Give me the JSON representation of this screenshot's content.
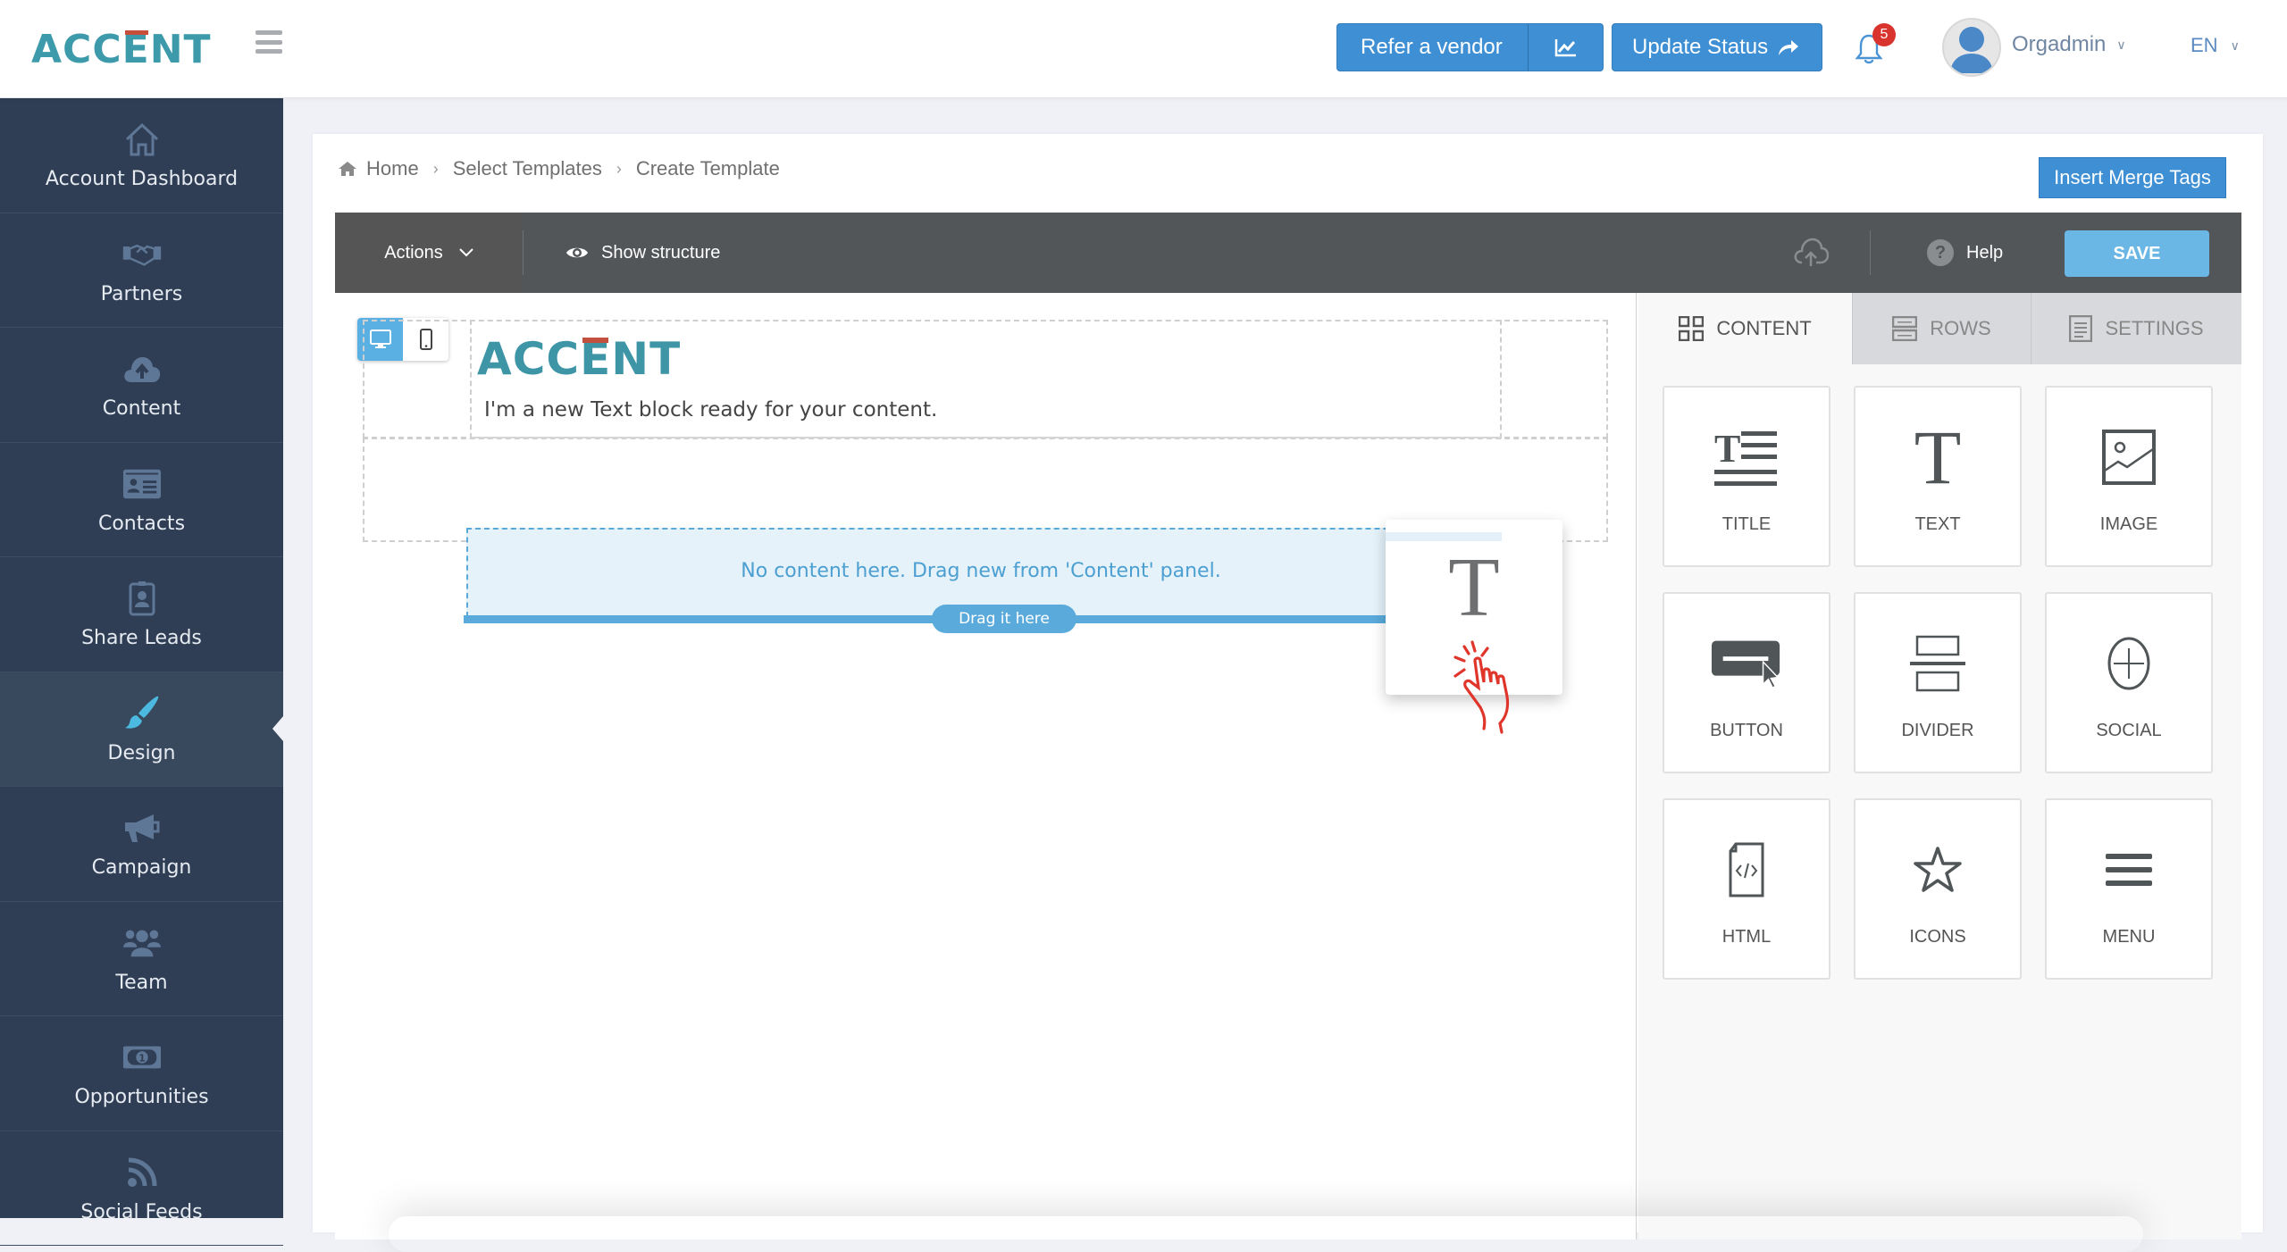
{
  "brand": {
    "logo_prefix": "ACC",
    "logo_e": "E",
    "logo_suffix": "NT"
  },
  "header": {
    "refer_vendor_label": "Refer a vendor",
    "update_status_label": "Update Status",
    "notifications_count": "5",
    "user_name": "Orgadmin",
    "language": "EN",
    "colors": {
      "primary_button": "#3e8fd3",
      "badge": "#d9332e"
    }
  },
  "sidebar": {
    "items": [
      {
        "label": "Account Dashboard",
        "icon": "home-icon"
      },
      {
        "label": "Partners",
        "icon": "handshake-icon"
      },
      {
        "label": "Content",
        "icon": "cloud-upload-icon"
      },
      {
        "label": "Contacts",
        "icon": "contact-card-icon"
      },
      {
        "label": "Share Leads",
        "icon": "badge-icon"
      },
      {
        "label": "Design",
        "icon": "paintbrush-icon",
        "active": true
      },
      {
        "label": "Campaign",
        "icon": "megaphone-icon"
      },
      {
        "label": "Team",
        "icon": "team-icon"
      },
      {
        "label": "Opportunities",
        "icon": "money-icon"
      },
      {
        "label": "Social Feeds",
        "icon": "rss-icon"
      }
    ]
  },
  "breadcrumb": {
    "items": [
      "Home",
      "Select Templates",
      "Create Template"
    ]
  },
  "merge_tags_label": "Insert Merge Tags",
  "toolbar": {
    "actions_label": "Actions",
    "show_structure_label": "Show structure",
    "help_label": "Help",
    "save_label": "SAVE"
  },
  "canvas": {
    "logo_prefix": "ACC",
    "logo_e": "E",
    "logo_suffix": "NT",
    "text_block": "I'm a new Text block ready for your content.",
    "empty_message": "No content here. Drag new from 'Content' panel.",
    "drag_hint": "Drag it here",
    "dragging_block": "T"
  },
  "panel": {
    "tabs": [
      {
        "label": "CONTENT",
        "active": true
      },
      {
        "label": "ROWS"
      },
      {
        "label": "SETTINGS"
      }
    ],
    "tiles": [
      {
        "label": "TITLE"
      },
      {
        "label": "TEXT"
      },
      {
        "label": "IMAGE"
      },
      {
        "label": "BUTTON"
      },
      {
        "label": "DIVIDER"
      },
      {
        "label": "SOCIAL"
      },
      {
        "label": "HTML"
      },
      {
        "label": "ICONS"
      },
      {
        "label": "MENU"
      }
    ]
  }
}
